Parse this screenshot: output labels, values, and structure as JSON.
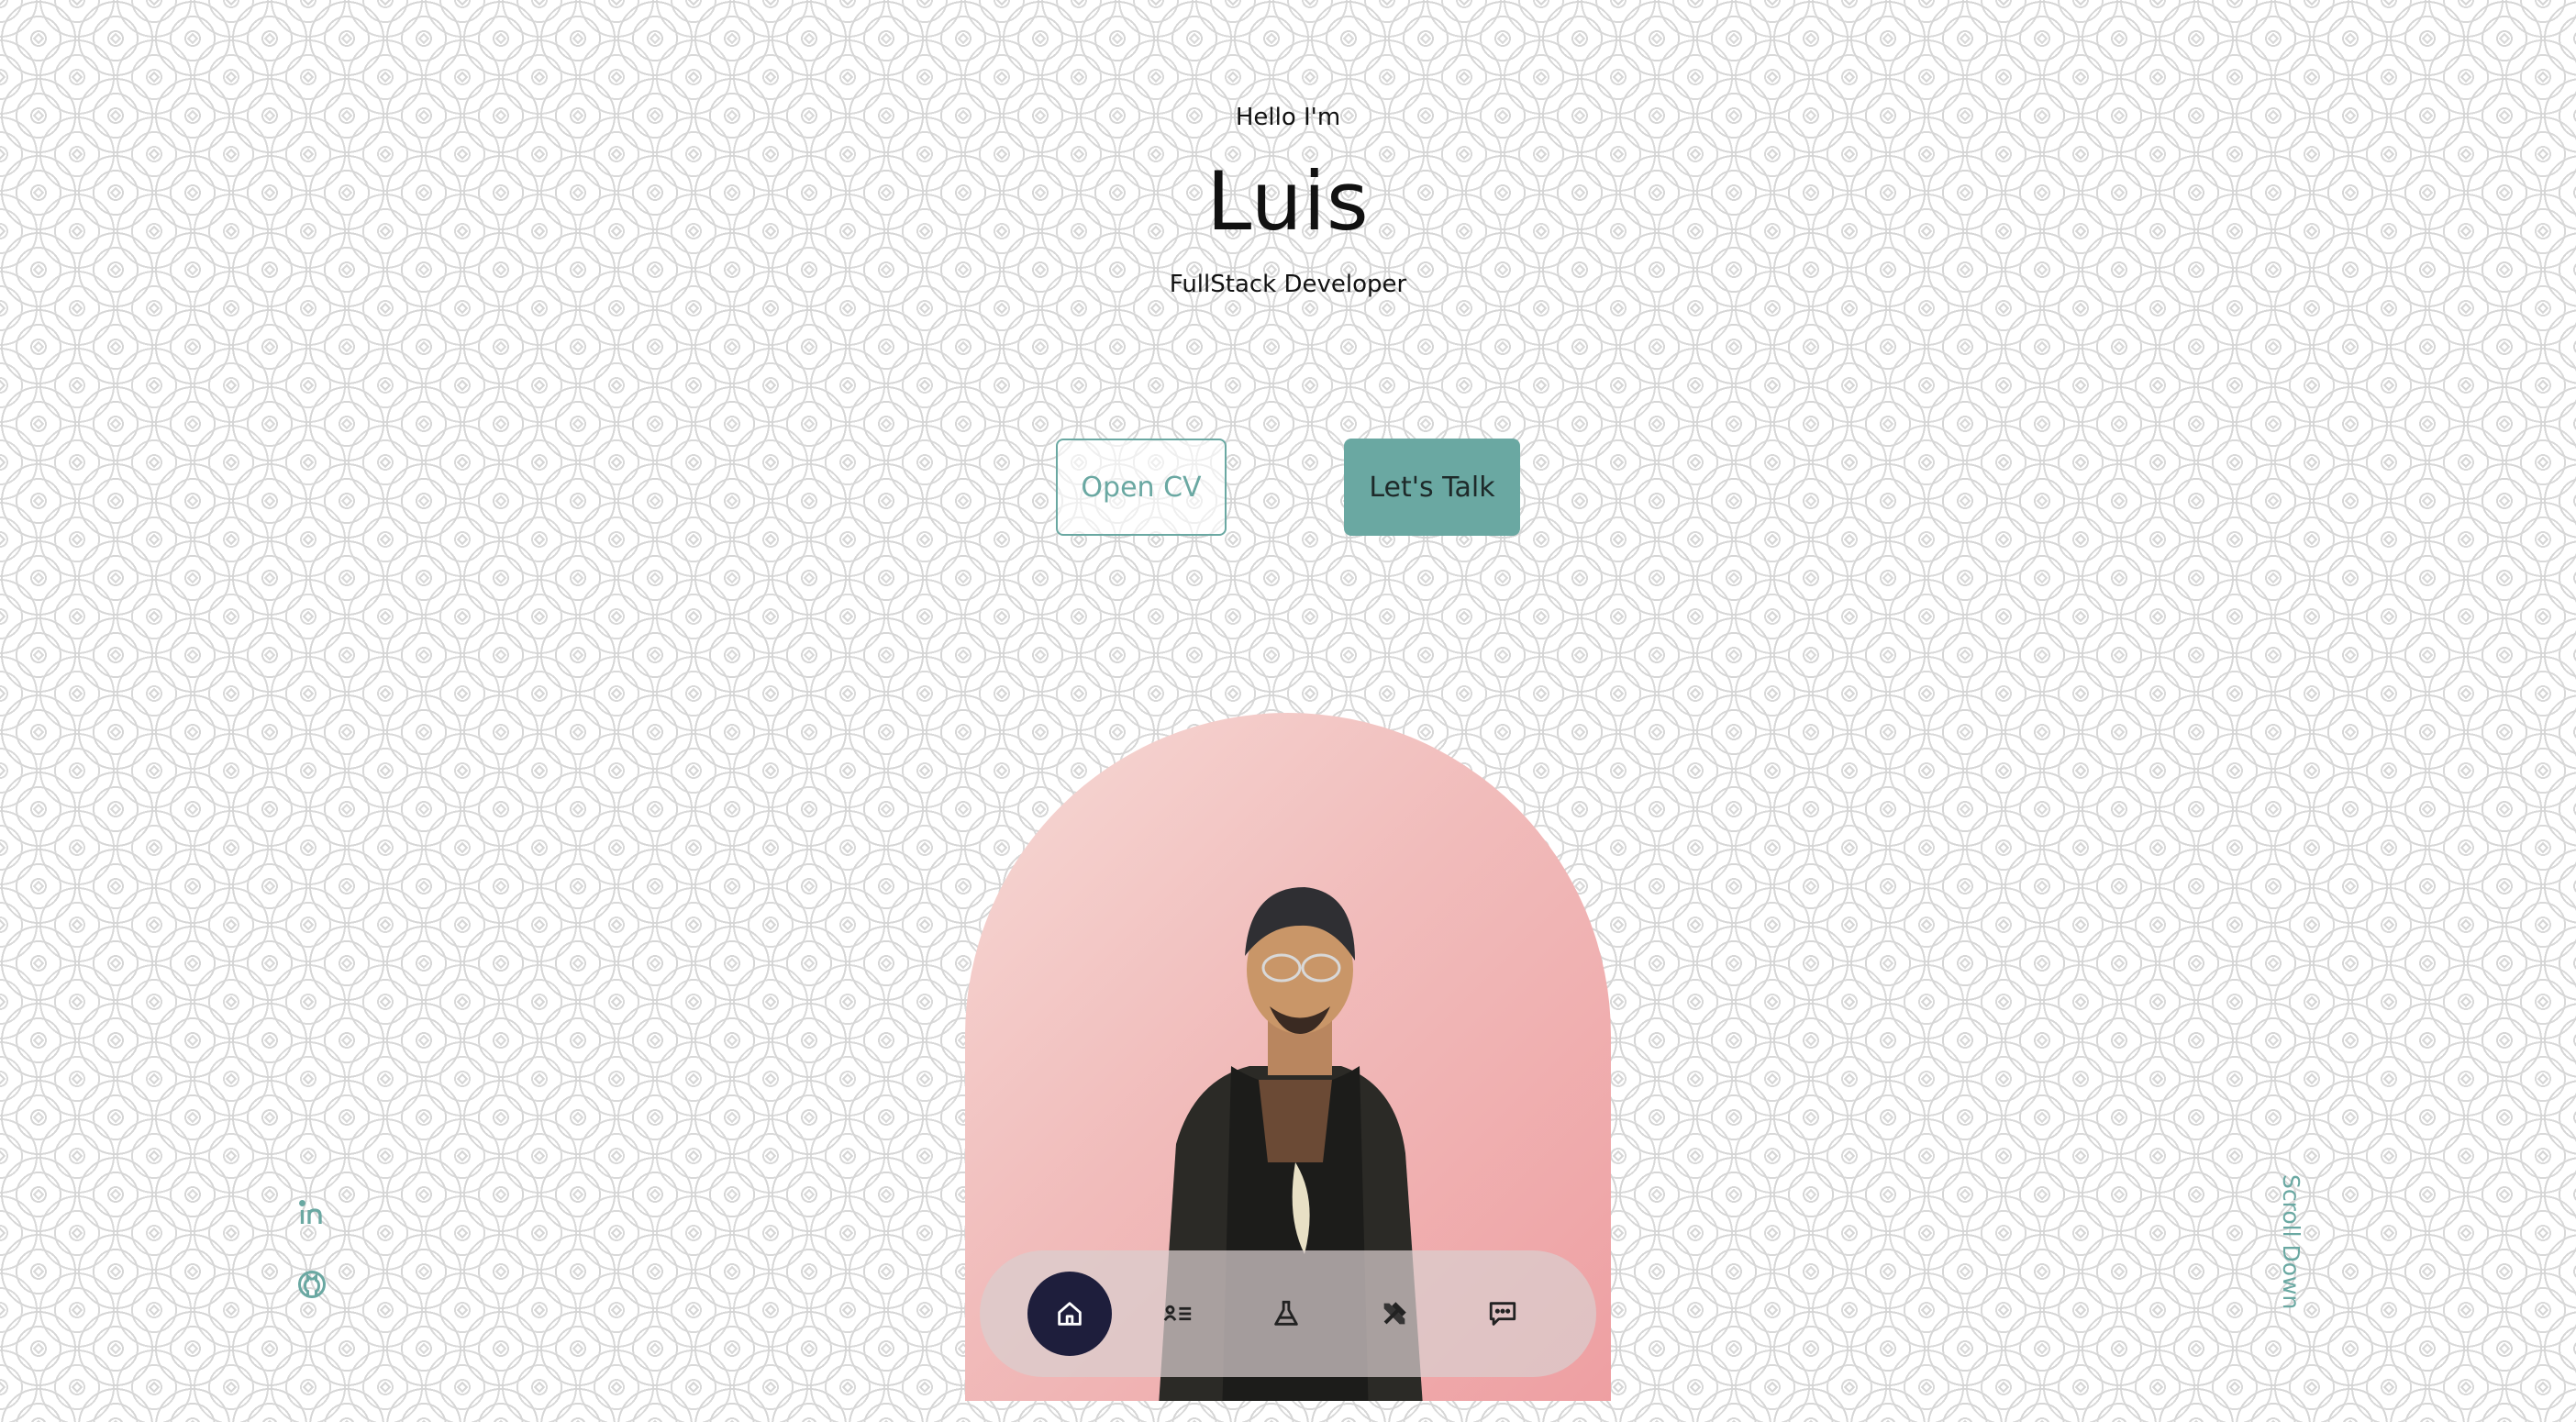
{
  "hero": {
    "greeting": "Hello I'm",
    "name": "Luis",
    "role": "FullStack Developer"
  },
  "buttons": {
    "cv_label": "Open CV",
    "talk_label": "Let's Talk"
  },
  "nav": {
    "items": [
      {
        "icon": "home-icon",
        "active": true
      },
      {
        "icon": "about-icon",
        "active": false
      },
      {
        "icon": "flask-icon",
        "active": false
      },
      {
        "icon": "tools-icon",
        "active": false
      },
      {
        "icon": "chat-icon",
        "active": false
      }
    ]
  },
  "social": {
    "items": [
      {
        "icon": "linkedin-icon"
      },
      {
        "icon": "github-icon"
      }
    ]
  },
  "scroll": {
    "label": "Scroll Down"
  },
  "colors": {
    "accent": "#6aa8a2",
    "nav_active": "#1e1e3c",
    "photo_bg": "#f1bcbb"
  }
}
